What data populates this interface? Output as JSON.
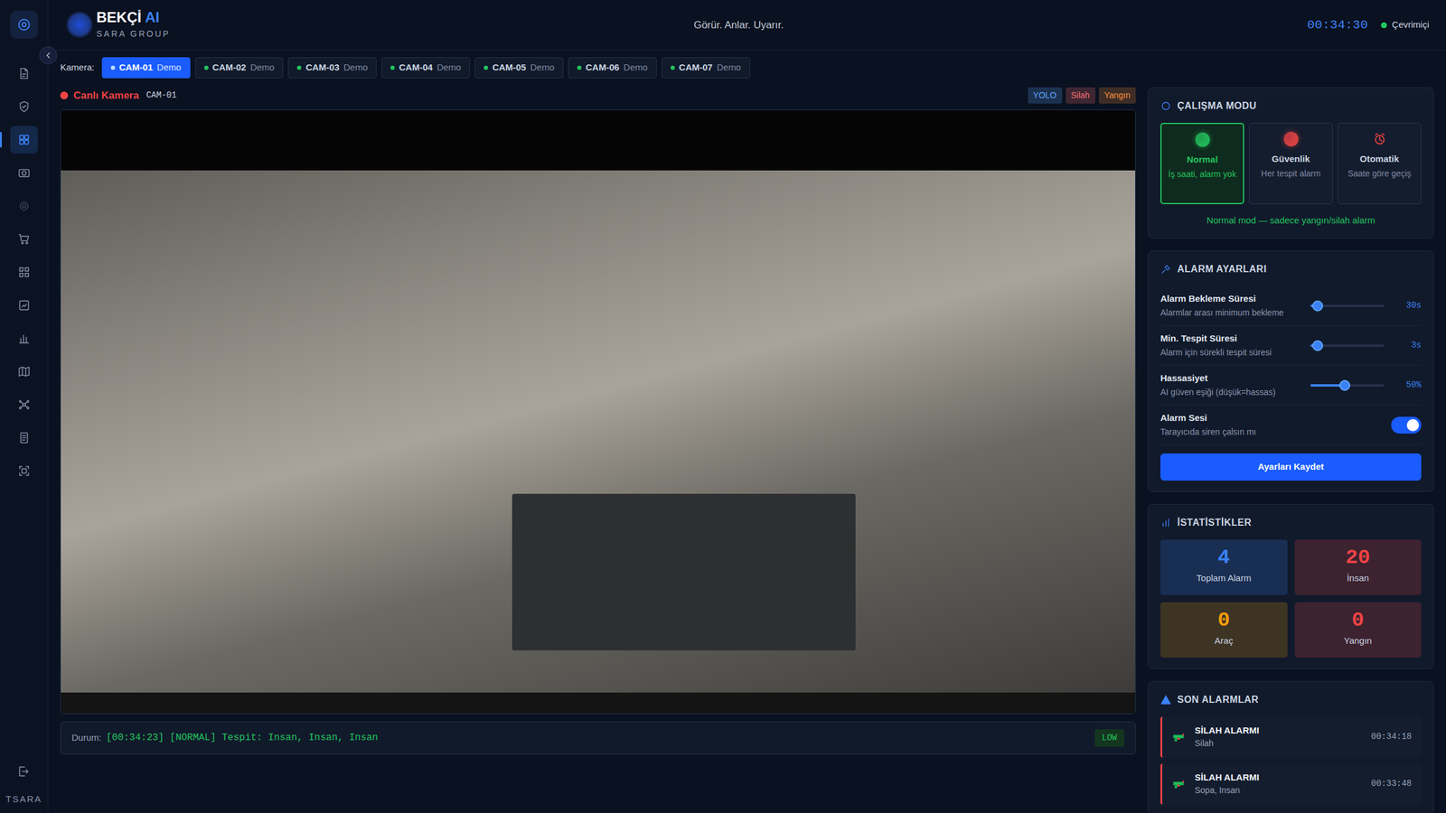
{
  "brand": {
    "name": "BEKÇİ",
    "suffix": "AI",
    "company": "SARA GROUP"
  },
  "tagline": "Görür. Anlar. Uyarır.",
  "clock": "00:34:30",
  "connection": {
    "label": "Çevrimiçi",
    "online": true
  },
  "sidebar": {
    "items": [
      {
        "selected": false
      },
      {
        "selected": false
      },
      {
        "selected": true
      },
      {
        "selected": false
      },
      {
        "selected": false
      },
      {
        "selected": false
      },
      {
        "selected": false
      },
      {
        "selected": false
      },
      {
        "selected": false
      },
      {
        "selected": false
      },
      {
        "selected": false
      },
      {
        "selected": false
      },
      {
        "selected": false
      }
    ],
    "footer": "TSARA"
  },
  "camera_bar": {
    "label": "Kamera:",
    "tabs": [
      {
        "name": "CAM-01",
        "tag": "Demo",
        "selected": true
      },
      {
        "name": "CAM-02",
        "tag": "Demo",
        "selected": false
      },
      {
        "name": "CAM-03",
        "tag": "Demo",
        "selected": false
      },
      {
        "name": "CAM-04",
        "tag": "Demo",
        "selected": false
      },
      {
        "name": "CAM-05",
        "tag": "Demo",
        "selected": false
      },
      {
        "name": "CAM-06",
        "tag": "Demo",
        "selected": false
      },
      {
        "name": "CAM-07",
        "tag": "Demo",
        "selected": false
      }
    ]
  },
  "live": {
    "label": "Canlı Kamera",
    "camera": "CAM-01",
    "badges": [
      {
        "label": "YOLO",
        "color": "#60a5fa"
      },
      {
        "label": "Silah",
        "color": "#f87171"
      },
      {
        "label": "Yangın",
        "color": "#fb923c"
      }
    ]
  },
  "status": {
    "label": "Durum:",
    "text": "[00:34:23] [NORMAL] Tespit: Insan, Insan, Insan",
    "risk": "LOW"
  },
  "mode": {
    "title": "ÇALIŞMA MODU",
    "options": [
      {
        "name": "Normal",
        "desc": "İş saati, alarm yok",
        "selected": true,
        "kind": "dot",
        "color": "#22c55e"
      },
      {
        "name": "Güvenlik",
        "desc": "Her tespit alarm",
        "selected": false,
        "kind": "dot",
        "color": "#ef4444"
      },
      {
        "name": "Otomatik",
        "desc": "Saate göre geçiş",
        "selected": false,
        "kind": "clock",
        "color": "#ef4444"
      }
    ],
    "note": "Normal mod — sadece yangın/silah alarm"
  },
  "alarm": {
    "title": "ALARM AYARLARI",
    "settings": [
      {
        "kind": "slider",
        "label": "Alarm Bekleme Süresi",
        "desc": "Alarmlar arası minimum bekleme",
        "level": 0.1,
        "reading": "30s"
      },
      {
        "kind": "slider",
        "label": "Min. Tespit Süresi",
        "desc": "Alarm için sürekli tespit süresi",
        "level": 0.1,
        "reading": "3s"
      },
      {
        "kind": "slider",
        "label": "Hassasiyet",
        "desc": "AI güven eşiği (düşük=hassas)",
        "level": 0.47,
        "reading": "50%"
      },
      {
        "kind": "toggle",
        "label": "Alarm Sesi",
        "desc": "Tarayıcıda siren çalsın mı",
        "on": true
      }
    ],
    "button": "Ayarları Kaydet"
  },
  "stats": {
    "title": "İSTATİSTİKLER",
    "tiles": [
      {
        "value": "4",
        "label": "Toplam Alarm",
        "color": "#3b82f6"
      },
      {
        "value": "20",
        "label": "İnsan",
        "color": "#ef4444"
      },
      {
        "value": "0",
        "label": "Araç",
        "color": "#f59e0b"
      },
      {
        "value": "0",
        "label": "Yangın",
        "color": "#ef4444"
      }
    ]
  },
  "alerts": {
    "title": "SON ALARMLAR",
    "items": [
      {
        "title": "SİLAH ALARMI",
        "detail": "Silah",
        "time": "00:34:18"
      },
      {
        "title": "SİLAH ALARMI",
        "detail": "Sopa, Insan",
        "time": "00:33:48"
      }
    ]
  }
}
